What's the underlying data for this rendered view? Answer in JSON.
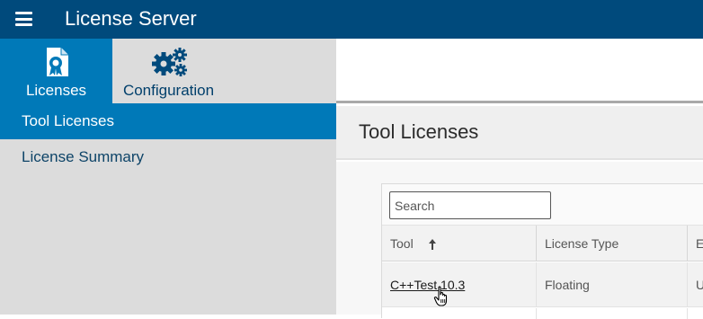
{
  "app": {
    "title": "License Server"
  },
  "mode_tabs": [
    {
      "label": "Licenses",
      "icon": "license-certificate-icon",
      "active": true
    },
    {
      "label": "Configuration",
      "icon": "gears-icon",
      "active": false
    }
  ],
  "nav": {
    "items": [
      {
        "label": "Tool Licenses",
        "active": true
      },
      {
        "label": "License Summary",
        "active": false
      }
    ]
  },
  "page": {
    "title": "Tool Licenses"
  },
  "search": {
    "placeholder": "Search",
    "value": ""
  },
  "table": {
    "columns": [
      "Tool",
      "License Type",
      "E"
    ],
    "sort": {
      "column": "Tool",
      "direction": "ascending",
      "icon": "sort-up-arrow-icon"
    },
    "rows": [
      {
        "tool": "C++Test 10.3",
        "license_type": "Floating",
        "third": "U"
      }
    ]
  },
  "colors": {
    "topbar": "#004a7c",
    "accent": "#0079b8",
    "sidebar_bg": "#dcdcdc"
  }
}
